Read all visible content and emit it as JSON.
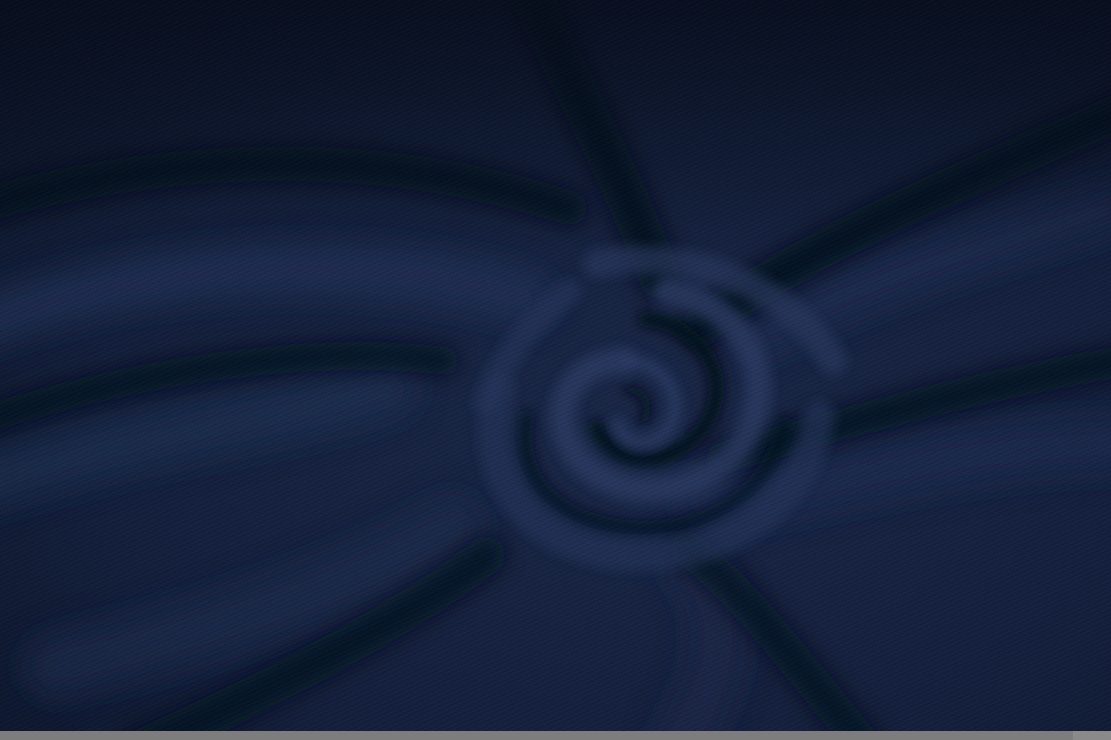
{
  "image": {
    "subject": "navy-blue-knit-fabric-swirl",
    "colors": {
      "fabric_base": "#16223f",
      "fabric_highlight": "#2a3a63",
      "fabric_shadow": "#060b17",
      "bottom_strip": "#8a8a8a"
    }
  }
}
